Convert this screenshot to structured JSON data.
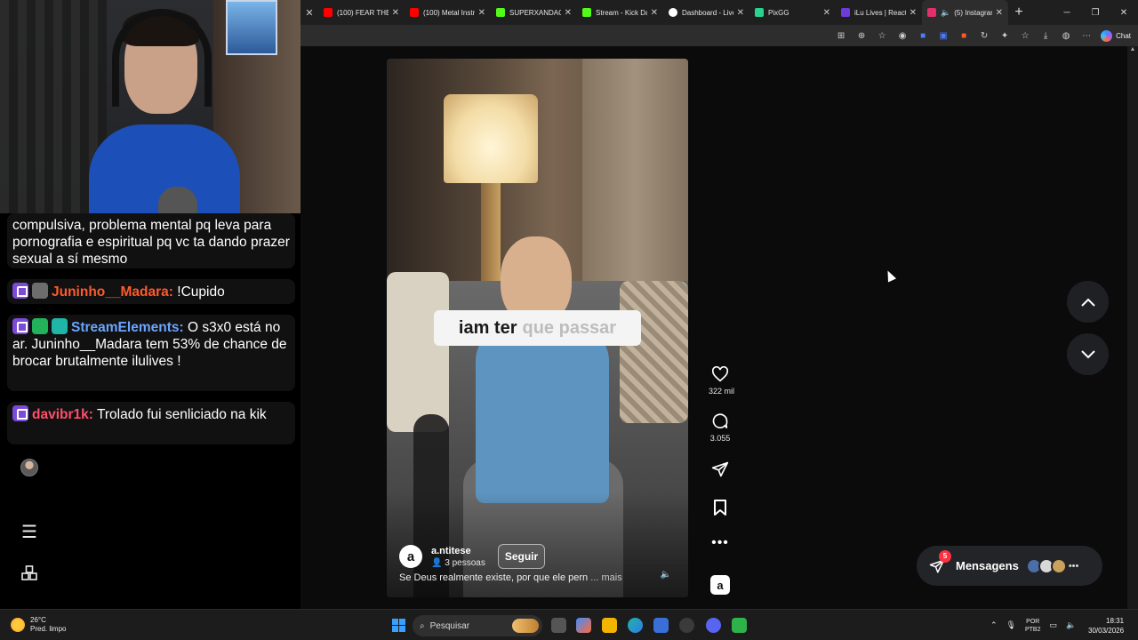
{
  "browser": {
    "tabs": [
      {
        "title": "(100) FEAR THE",
        "color": "#ff0000"
      },
      {
        "title": "(100) Metal Instr",
        "color": "#ff0000"
      },
      {
        "title": "SUPERXANDAO",
        "color": "#53fc18"
      },
      {
        "title": "Stream - Kick Da",
        "color": "#53fc18"
      },
      {
        "title": "Dashboard - Live",
        "color": "#ffffff"
      },
      {
        "title": "PixGG",
        "color": "#2ad28e"
      },
      {
        "title": "iLu Lives | React",
        "color": "#6d3bd6"
      },
      {
        "title": "(5) Instagram",
        "color": "#e1306c"
      }
    ],
    "chat_label": "Chat"
  },
  "stream_chat": {
    "messages": [
      {
        "user": "",
        "text": "compulsiva, problema mental pq leva para pornografia e espiritual pq vc ta dando prazer sexual a sí mesmo"
      },
      {
        "user": "Juninho__Madara",
        "text": "!Cupido"
      },
      {
        "user": "StreamElements",
        "text": "O s3x0 está no ar. Juninho__Madara tem 53% de chance de brocar brutalmente ilulives !"
      },
      {
        "user": "davibr1k",
        "text": "Trolado fui senliciado na kik"
      }
    ],
    "separator": ":"
  },
  "reel": {
    "caption_word1": "iam ter",
    "caption_word2": "que passar",
    "account_initial": "a",
    "username": "a.ntitese",
    "people": "3 pessoas",
    "follow_label": "Seguir",
    "description": "Se Deus realmente existe, por que ele pern",
    "more_label": "... mais",
    "likes": "322 mil",
    "comments": "3.055"
  },
  "messages_bar": {
    "label": "Mensagens",
    "badge": "5"
  },
  "taskbar": {
    "temperature": "26°C",
    "weather_text": "Pred. limpo",
    "search_placeholder": "Pesquisar",
    "lang_top": "POR",
    "lang_bottom": "PTB2",
    "time": "18:31",
    "date": "30/03/2026"
  },
  "colors": {
    "twitch": "#7b4bd8",
    "instagram_badge": "#ff3040",
    "windows_blue": "#3aa0ff"
  }
}
